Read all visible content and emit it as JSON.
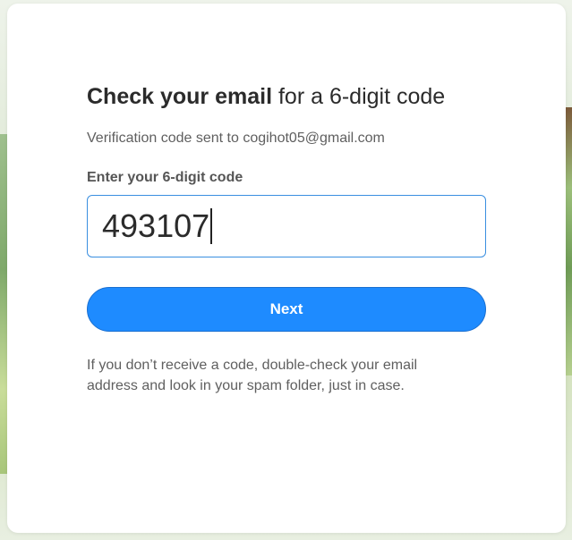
{
  "heading": {
    "strong": "Check your email",
    "rest": " for a 6-digit code"
  },
  "subtitle": "Verification code sent to cogihot05@gmail.com",
  "code_field": {
    "label": "Enter your 6-digit code",
    "value": "493107"
  },
  "next_button": {
    "label": "Next"
  },
  "help_text": "If you don’t receive a code, double-check your email address and look in your spam folder, just in case.",
  "colors": {
    "accent": "#1e8bff",
    "input_border": "#3a8fe0",
    "text": "#2b2b2b"
  }
}
